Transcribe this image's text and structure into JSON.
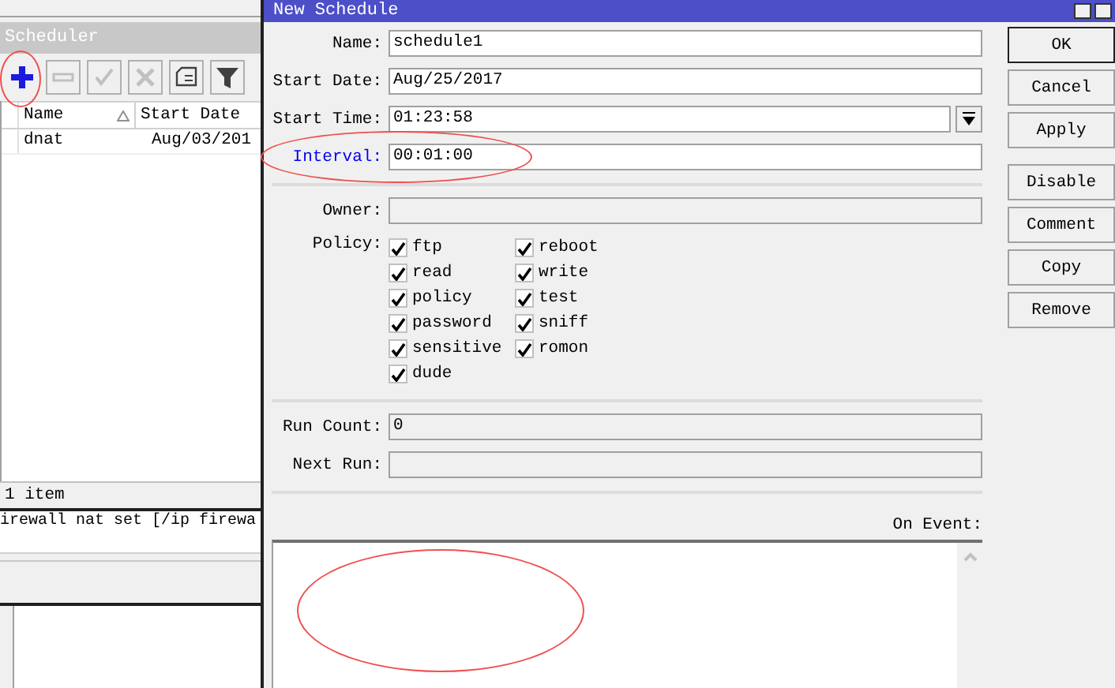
{
  "scheduler_window": {
    "title": "Scheduler",
    "toolbar": [
      {
        "kind": "add",
        "disabled": false,
        "highlighted": true
      },
      {
        "kind": "remove",
        "disabled": true,
        "highlighted": false
      },
      {
        "kind": "enable",
        "disabled": true,
        "highlighted": false
      },
      {
        "kind": "disable",
        "disabled": true,
        "highlighted": false
      },
      {
        "kind": "comment",
        "disabled": false,
        "highlighted": false
      },
      {
        "kind": "filter",
        "disabled": false,
        "highlighted": false
      }
    ],
    "table": {
      "columns": [
        {
          "label": "Name",
          "sorted": true
        },
        {
          "label": "Start Date",
          "sorted": false
        }
      ],
      "rows": [
        {
          "cells": [
            "dnat",
            "Aug/03/201"
          ],
          "selected": false
        }
      ]
    },
    "status_bar": "1 item"
  },
  "console": {
    "line": "irewall nat set [/ip firewa"
  },
  "dialog": {
    "title": "New Schedule",
    "fields": [
      {
        "kind": "text",
        "label": "Name:",
        "value": "schedule1",
        "disabled": false,
        "modified": false,
        "highlighted": false
      },
      {
        "kind": "text",
        "label": "Start Date:",
        "value": "Aug/25/2017",
        "disabled": false,
        "modified": false,
        "highlighted": false
      },
      {
        "kind": "dropdown",
        "label": "Start Time:",
        "value": "01:23:58",
        "disabled": false,
        "modified": false,
        "highlighted": false
      },
      {
        "kind": "text",
        "label": "Interval:",
        "value": "00:01:00",
        "disabled": false,
        "modified": true,
        "highlighted": true
      },
      {
        "kind": "separator"
      },
      {
        "kind": "text",
        "label": "Owner:",
        "disabled": true,
        "modified": false,
        "highlighted": false
      },
      {
        "kind": "policy",
        "label": "Policy:",
        "columns": [
          [
            {
              "label": "ftp",
              "checked": true
            },
            {
              "label": "read",
              "checked": true
            },
            {
              "label": "policy",
              "checked": true
            },
            {
              "label": "password",
              "checked": true
            },
            {
              "label": "sensitive",
              "checked": true
            },
            {
              "label": "dude",
              "checked": true
            }
          ],
          [
            {
              "label": "reboot",
              "checked": true
            },
            {
              "label": "write",
              "checked": true
            },
            {
              "label": "test",
              "checked": true
            },
            {
              "label": "sniff",
              "checked": true
            },
            {
              "label": "romon",
              "checked": true
            }
          ]
        ]
      },
      {
        "kind": "separator"
      },
      {
        "kind": "text",
        "label": "Run Count:",
        "value": "0",
        "disabled": true,
        "modified": false,
        "highlighted": false
      },
      {
        "kind": "text",
        "label": "Next Run:",
        "disabled": true,
        "modified": false,
        "highlighted": false
      },
      {
        "kind": "separator"
      }
    ],
    "on_event": {
      "label": "On Event:",
      "highlighted": true
    },
    "button_groups": [
      [
        {
          "label": "OK",
          "default": true
        },
        {
          "label": "Cancel",
          "default": false
        },
        {
          "label": "Apply",
          "default": false
        }
      ],
      [
        {
          "label": "Disable",
          "default": false
        },
        {
          "label": "Comment",
          "default": false
        },
        {
          "label": "Copy",
          "default": false
        },
        {
          "label": "Remove",
          "default": false
        }
      ]
    ]
  }
}
